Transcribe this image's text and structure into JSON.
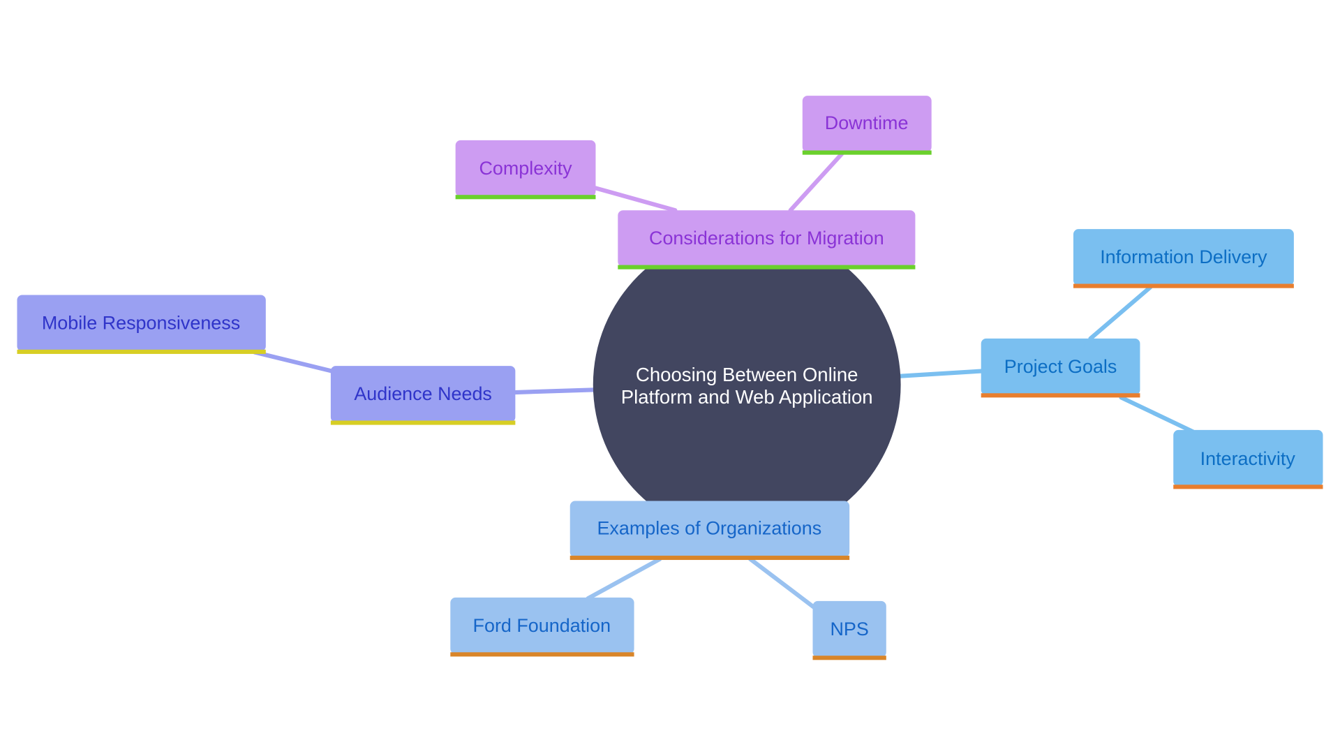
{
  "diagram": {
    "type": "mindmap",
    "root": {
      "label_line1": "Choosing Between Online",
      "label_line2": "Platform and Web Application",
      "color": "#424660",
      "text_color": "#ffffff"
    },
    "branches": [
      {
        "id": "considerations",
        "label": "Considerations for Migration",
        "fill": "#cd9cf2",
        "text_color": "#8a33d6",
        "underline": "#6ad02c",
        "edge": "#cd9cf2",
        "children": [
          {
            "id": "complexity",
            "label": "Complexity"
          },
          {
            "id": "downtime",
            "label": "Downtime"
          }
        ]
      },
      {
        "id": "project-goals",
        "label": "Project Goals",
        "fill": "#7abff0",
        "text_color": "#0c6ec4",
        "underline": "#e87e2e",
        "edge": "#7abff0",
        "children": [
          {
            "id": "information-delivery",
            "label": "Information Delivery"
          },
          {
            "id": "interactivity",
            "label": "Interactivity"
          }
        ]
      },
      {
        "id": "audience-needs",
        "label": "Audience Needs",
        "fill": "#9aa0f2",
        "text_color": "#2f34c9",
        "underline": "#d7ce24",
        "edge": "#9aa0f2",
        "children": [
          {
            "id": "mobile-responsiveness",
            "label": "Mobile Responsiveness"
          }
        ]
      },
      {
        "id": "examples",
        "label": "Examples of Organizations",
        "fill": "#9ac2f0",
        "text_color": "#1565c8",
        "underline": "#d98529",
        "edge": "#9ac2f0",
        "children": [
          {
            "id": "ford-foundation",
            "label": "Ford Foundation"
          },
          {
            "id": "nps",
            "label": "NPS"
          }
        ]
      }
    ]
  }
}
